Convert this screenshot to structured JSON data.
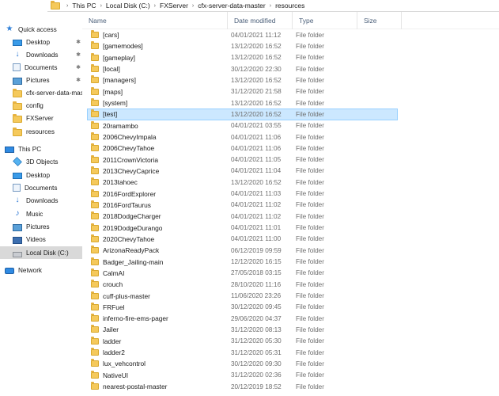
{
  "address_bar": {
    "crumbs": [
      "This PC",
      "Local Disk (C:)",
      "FXServer",
      "cfx-server-data-master",
      "resources"
    ],
    "separator": "›"
  },
  "nav": {
    "items": [
      {
        "label": "Quick access",
        "icon": "star-icon",
        "pinned": false,
        "selected": false
      },
      {
        "label": "Desktop",
        "icon": "desktop-icon",
        "pinned": true,
        "selected": false
      },
      {
        "label": "Downloads",
        "icon": "download-icon",
        "pinned": true,
        "selected": false
      },
      {
        "label": "Documents",
        "icon": "documents-icon",
        "pinned": true,
        "selected": false
      },
      {
        "label": "Pictures",
        "icon": "pictures-icon",
        "pinned": true,
        "selected": false
      },
      {
        "label": "cfx-server-data-master",
        "icon": "folder-icon",
        "pinned": false,
        "selected": false
      },
      {
        "label": "config",
        "icon": "folder-icon",
        "pinned": false,
        "selected": false
      },
      {
        "label": "FXServer",
        "icon": "folder-icon",
        "pinned": false,
        "selected": false
      },
      {
        "label": "resources",
        "icon": "folder-icon",
        "pinned": false,
        "selected": false
      },
      {
        "label": "This PC",
        "icon": "computer-icon",
        "pinned": false,
        "selected": false
      },
      {
        "label": "3D Objects",
        "icon": "3d-objects-icon",
        "pinned": false,
        "selected": false
      },
      {
        "label": "Desktop",
        "icon": "desktop-icon",
        "pinned": false,
        "selected": false
      },
      {
        "label": "Documents",
        "icon": "documents-icon",
        "pinned": false,
        "selected": false
      },
      {
        "label": "Downloads",
        "icon": "download-icon",
        "pinned": false,
        "selected": false
      },
      {
        "label": "Music",
        "icon": "music-icon",
        "pinned": false,
        "selected": false
      },
      {
        "label": "Pictures",
        "icon": "pictures-icon",
        "pinned": false,
        "selected": false
      },
      {
        "label": "Videos",
        "icon": "videos-icon",
        "pinned": false,
        "selected": false
      },
      {
        "label": "Local Disk (C:)",
        "icon": "disk-icon",
        "pinned": false,
        "selected": true
      },
      {
        "label": "Network",
        "icon": "network-icon",
        "pinned": false,
        "selected": false
      }
    ],
    "pin_glyph": "✱"
  },
  "columns": [
    {
      "label": "Name"
    },
    {
      "label": "Date modified"
    },
    {
      "label": "Type"
    },
    {
      "label": "Size"
    }
  ],
  "files": [
    {
      "name": "[cars]",
      "date": "04/01/2021 11:12",
      "type": "File folder"
    },
    {
      "name": "[gamemodes]",
      "date": "13/12/2020 16:52",
      "type": "File folder"
    },
    {
      "name": "[gameplay]",
      "date": "13/12/2020 16:52",
      "type": "File folder"
    },
    {
      "name": "[local]",
      "date": "30/12/2020 22:30",
      "type": "File folder"
    },
    {
      "name": "[managers]",
      "date": "13/12/2020 16:52",
      "type": "File folder"
    },
    {
      "name": "[maps]",
      "date": "31/12/2020 21:58",
      "type": "File folder"
    },
    {
      "name": "[system]",
      "date": "13/12/2020 16:52",
      "type": "File folder"
    },
    {
      "name": "[test]",
      "date": "13/12/2020 16:52",
      "type": "File folder",
      "selected": true
    },
    {
      "name": "20ramambo",
      "date": "04/01/2021 03:55",
      "type": "File folder"
    },
    {
      "name": "2006ChevyImpala",
      "date": "04/01/2021 11:06",
      "type": "File folder"
    },
    {
      "name": "2006ChevyTahoe",
      "date": "04/01/2021 11:06",
      "type": "File folder"
    },
    {
      "name": "2011CrownVictoria",
      "date": "04/01/2021 11:05",
      "type": "File folder"
    },
    {
      "name": "2013ChevyCaprice",
      "date": "04/01/2021 11:04",
      "type": "File folder"
    },
    {
      "name": "2013tahoec",
      "date": "13/12/2020 16:52",
      "type": "File folder"
    },
    {
      "name": "2016FordExplorer",
      "date": "04/01/2021 11:03",
      "type": "File folder"
    },
    {
      "name": "2016FordTaurus",
      "date": "04/01/2021 11:02",
      "type": "File folder"
    },
    {
      "name": "2018DodgeCharger",
      "date": "04/01/2021 11:02",
      "type": "File folder"
    },
    {
      "name": "2019DodgeDurango",
      "date": "04/01/2021 11:01",
      "type": "File folder"
    },
    {
      "name": "2020ChevyTahoe",
      "date": "04/01/2021 11:00",
      "type": "File folder"
    },
    {
      "name": "ArizonaReadyPack",
      "date": "06/12/2019 09:59",
      "type": "File folder"
    },
    {
      "name": "Badger_Jailing-main",
      "date": "12/12/2020 16:15",
      "type": "File folder"
    },
    {
      "name": "CalmAI",
      "date": "27/05/2018 03:15",
      "type": "File folder"
    },
    {
      "name": "crouch",
      "date": "28/10/2020 11:16",
      "type": "File folder"
    },
    {
      "name": "cuff-plus-master",
      "date": "11/06/2020 23:26",
      "type": "File folder"
    },
    {
      "name": "FRFuel",
      "date": "30/12/2020 09:45",
      "type": "File folder"
    },
    {
      "name": "inferno-fire-ems-pager",
      "date": "29/06/2020 04:37",
      "type": "File folder"
    },
    {
      "name": "Jailer",
      "date": "31/12/2020 08:13",
      "type": "File folder"
    },
    {
      "name": "ladder",
      "date": "31/12/2020 05:30",
      "type": "File folder"
    },
    {
      "name": "ladder2",
      "date": "31/12/2020 05:31",
      "type": "File folder"
    },
    {
      "name": "lux_vehcontrol",
      "date": "30/12/2020 09:30",
      "type": "File folder"
    },
    {
      "name": "NativeUI",
      "date": "31/12/2020 02:36",
      "type": "File folder"
    },
    {
      "name": "nearest-postal-master",
      "date": "20/12/2019 18:52",
      "type": "File folder"
    }
  ]
}
